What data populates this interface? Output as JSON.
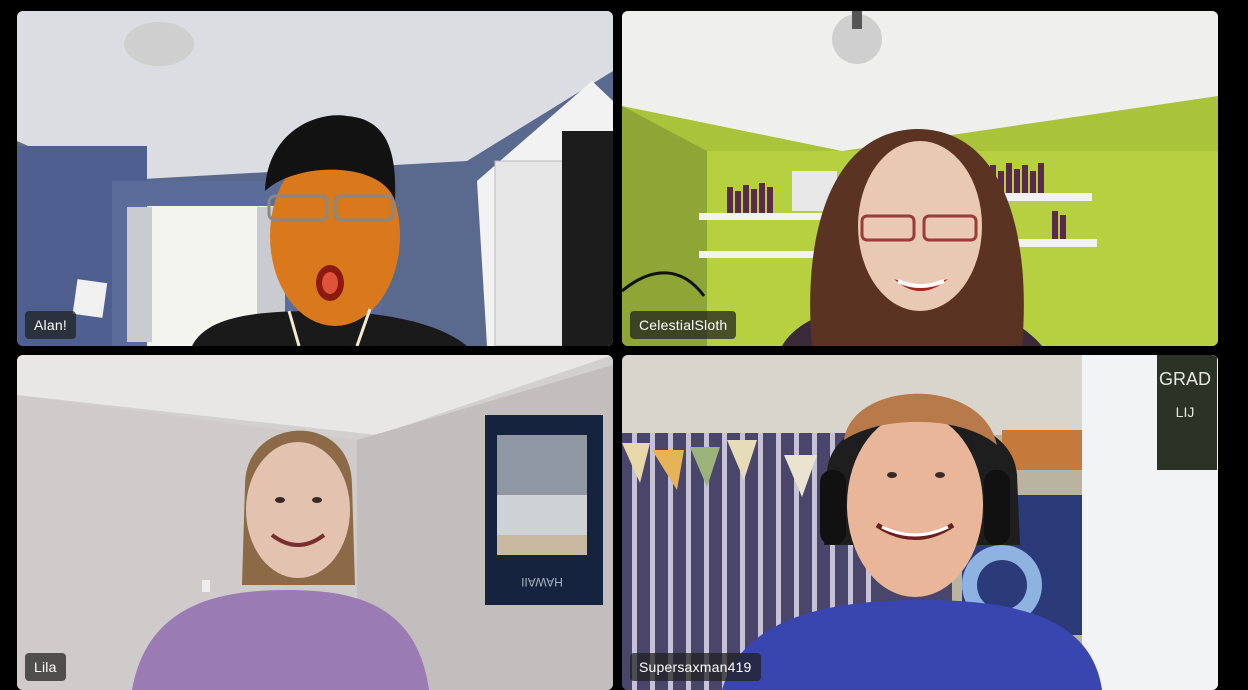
{
  "meeting": {
    "participants": [
      {
        "name": "Alan!"
      },
      {
        "name": "CelestialSloth"
      },
      {
        "name": "Lila"
      },
      {
        "name": "Supersaxman419"
      }
    ]
  },
  "scene_text": {
    "poster_caption": "HAWAII",
    "pennant_top": "GRAD",
    "pennant_sub": "LIJ"
  },
  "colors": {
    "background": "#000000",
    "name_tag_bg": "rgba(30,30,30,0.72)",
    "name_tag_text": "#ffffff"
  }
}
